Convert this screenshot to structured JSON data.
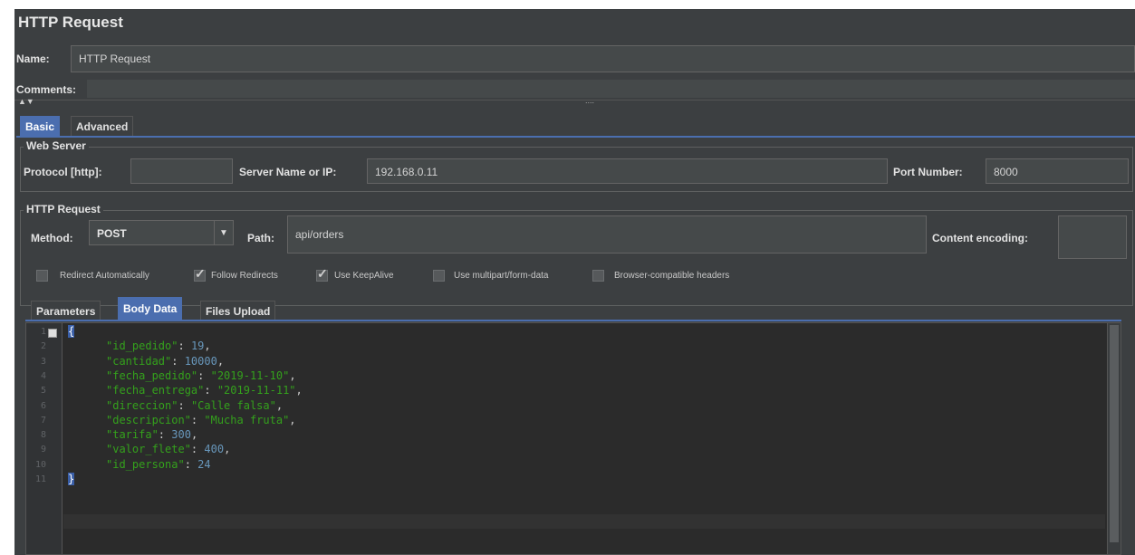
{
  "panel_title": "HTTP Request",
  "name": {
    "label": "Name:",
    "value": "HTTP Request"
  },
  "comments": {
    "label": "Comments:",
    "value": ""
  },
  "splitter_grip": "....",
  "main_tabs": [
    {
      "label": "Basic",
      "active": true
    },
    {
      "label": "Advanced",
      "active": false
    }
  ],
  "web_server": {
    "title": "Web Server",
    "protocol_label": "Protocol [http]:",
    "protocol_value": "",
    "server_label": "Server Name or IP:",
    "server_value": "192.168.0.11",
    "port_label": "Port Number:",
    "port_value": "8000"
  },
  "http_request": {
    "title": "HTTP Request",
    "method_label": "Method:",
    "method_value": "POST",
    "path_label": "Path:",
    "path_value": "api/orders",
    "encoding_label": "Content encoding:",
    "encoding_value": ""
  },
  "options": [
    {
      "label": "Redirect Automatically",
      "checked": false
    },
    {
      "label": "Follow Redirects",
      "checked": true
    },
    {
      "label": "Use KeepAlive",
      "checked": true
    },
    {
      "label": "Use multipart/form-data",
      "checked": false
    },
    {
      "label": "Browser-compatible headers",
      "checked": false
    }
  ],
  "body_tabs": [
    {
      "label": "Parameters",
      "active": false
    },
    {
      "label": "Body Data",
      "active": true
    },
    {
      "label": "Files Upload",
      "active": false
    }
  ],
  "editor": {
    "line_numbers": [
      "1",
      "2",
      "3",
      "4",
      "5",
      "6",
      "7",
      "8",
      "9",
      "10",
      "11"
    ],
    "open_brace": "{",
    "close_brace": "}",
    "fields": [
      {
        "key": "\"id_pedido\"",
        "value": "19",
        "type": "num",
        "comma": true
      },
      {
        "key": "\"cantidad\"",
        "value": "10000",
        "type": "num",
        "comma": true
      },
      {
        "key": "\"fecha_pedido\"",
        "value": "\"2019-11-10\"",
        "type": "str",
        "comma": true
      },
      {
        "key": "\"fecha_entrega\"",
        "value": "\"2019-11-11\"",
        "type": "str",
        "comma": true
      },
      {
        "key": "\"direccion\"",
        "value": "\"Calle falsa\"",
        "type": "str",
        "comma": true
      },
      {
        "key": "\"descripcion\"",
        "value": "\"Mucha fruta\"",
        "type": "str",
        "comma": true
      },
      {
        "key": "\"tarifa\"",
        "value": "300",
        "type": "num",
        "comma": true
      },
      {
        "key": "\"valor_flete\"",
        "value": "400",
        "type": "num",
        "comma": true
      },
      {
        "key": "\"id_persona\"",
        "value": "24",
        "type": "num",
        "comma": false
      }
    ]
  },
  "colors": {
    "background": "#3c3f41",
    "active_tab": "#4b6eaf",
    "editor_background": "#2b2b2b",
    "json_key": "#34a11c",
    "json_number": "#6897bb"
  }
}
